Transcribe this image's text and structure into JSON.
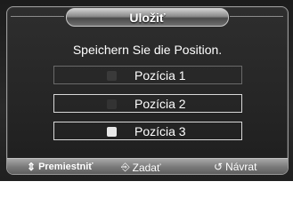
{
  "dialog": {
    "title": "Uložiť",
    "message": "Speichern Sie die Position."
  },
  "options": [
    {
      "label": "Pozícia 1",
      "marker_color": "#3a3a3a"
    },
    {
      "label": "Pozícia 2",
      "marker_color": "#3a3a3a"
    },
    {
      "label": "Pozícia 3",
      "marker_color": "#e8e8e8"
    }
  ],
  "footer": {
    "move_label": "Premiestniť",
    "move_icon": "updown-arrows-icon",
    "enter_label": "Zadať",
    "enter_icon": "enter-icon",
    "back_label": "Návrat",
    "back_icon": "return-icon"
  },
  "colors": {
    "text": "#ffffff",
    "selected_border": "#d8d8d8"
  }
}
